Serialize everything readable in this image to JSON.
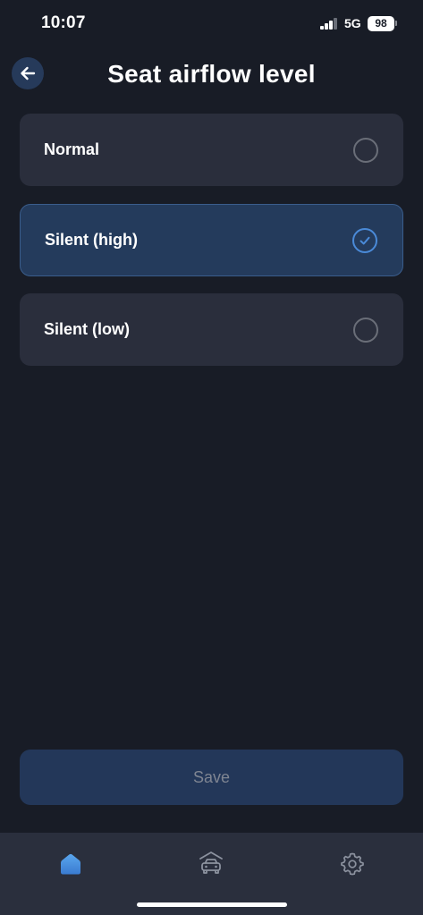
{
  "status_bar": {
    "time": "10:07",
    "network": "5G",
    "battery": "98"
  },
  "header": {
    "title": "Seat airflow level",
    "back_icon": "arrow-left-icon"
  },
  "options": [
    {
      "label": "Normal",
      "selected": false
    },
    {
      "label": "Silent (high)",
      "selected": true
    },
    {
      "label": "Silent (low)",
      "selected": false
    }
  ],
  "save": {
    "label": "Save",
    "enabled": false
  },
  "tab_bar": {
    "tabs": [
      {
        "icon": "home-icon",
        "active": true
      },
      {
        "icon": "car-garage-icon",
        "active": false
      },
      {
        "icon": "settings-gear-icon",
        "active": false
      }
    ]
  },
  "colors": {
    "background": "#181c26",
    "card": "#2a2e3c",
    "selected_card": "#243b5c",
    "accent": "#4a8ad8",
    "tab_bar": "#2a2f3d"
  }
}
